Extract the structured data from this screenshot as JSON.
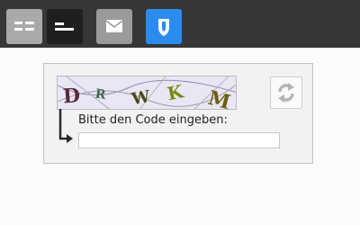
{
  "toolbar": {
    "buttons": [
      {
        "icon": "layout-icon"
      },
      {
        "icon": "collapse-icon"
      },
      {
        "icon": "mail-icon"
      },
      {
        "icon": "shield-icon",
        "active": true
      }
    ],
    "colors": {
      "bar": "#363636",
      "active": "#2b8cf0"
    }
  },
  "captcha": {
    "letters": [
      "D",
      "R",
      "W",
      "K",
      "M"
    ],
    "letter_colors": [
      "#5a2a3a",
      "#3a6a4a",
      "#4a4a10",
      "#7a8a10",
      "#6a6010"
    ],
    "prompt": "Bitte den Code eingeben:",
    "input_value": "",
    "refresh_icon": "refresh-icon"
  }
}
